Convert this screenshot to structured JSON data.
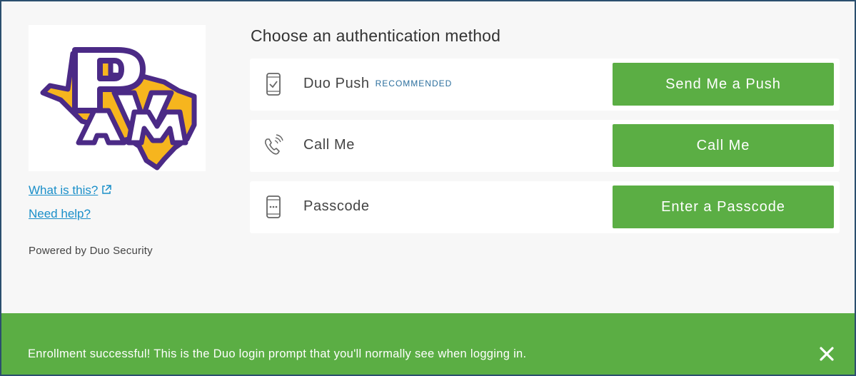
{
  "sidebar": {
    "logo_text": "PVAM",
    "what_is_this": "What is this?",
    "need_help": "Need help?",
    "powered_by": "Powered by Duo Security"
  },
  "main": {
    "heading": "Choose an authentication method",
    "methods": [
      {
        "icon": "smartphone-check-icon",
        "label": "Duo Push",
        "badge": "RECOMMENDED",
        "button": "Send Me a Push"
      },
      {
        "icon": "phone-call-icon",
        "label": "Call Me",
        "badge": "",
        "button": "Call Me"
      },
      {
        "icon": "passcode-device-icon",
        "label": "Passcode",
        "badge": "",
        "button": "Enter a Passcode"
      }
    ]
  },
  "notice": {
    "message": "Enrollment successful! This is the Duo login prompt that you'll normally see when logging in.",
    "close_icon": "close-icon"
  },
  "colors": {
    "accent_green": "#5bae44",
    "link_blue": "#1a8fc9",
    "background": "#f7f7f7",
    "border": "#2b4f6e",
    "logo_purple": "#4b2a86",
    "logo_gold": "#f6b51e"
  }
}
